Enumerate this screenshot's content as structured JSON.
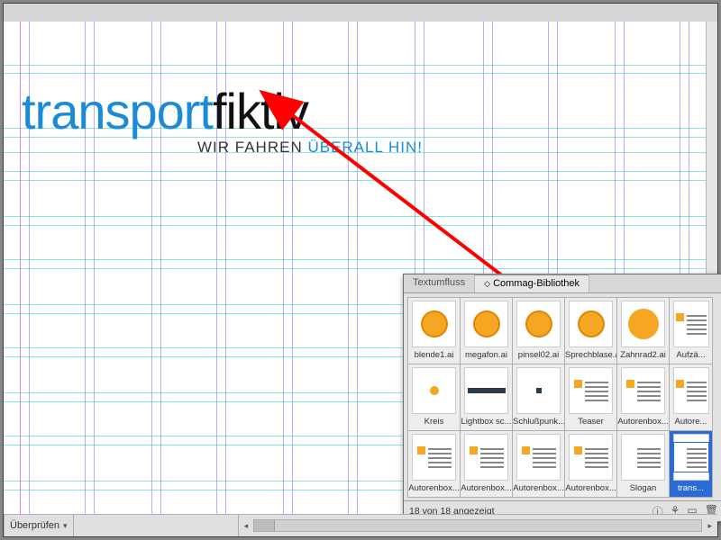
{
  "app": {
    "tab_text_wrap": "Textumfluss",
    "tab_library": "Commag-Bibliothek"
  },
  "document": {
    "logo_part1": "transport",
    "logo_part2": "fiktiv",
    "tagline_part1": "WIR FAHREN ",
    "tagline_part2": "ÜBERALL HIN!"
  },
  "library": {
    "items": [
      {
        "name": "blende1.ai"
      },
      {
        "name": "megafon.ai"
      },
      {
        "name": "pinsel02.ai"
      },
      {
        "name": "Sprechblase.ai"
      },
      {
        "name": "Zahnrad2.ai"
      },
      {
        "name": "Aufzä..."
      },
      {
        "name": "Kreis"
      },
      {
        "name": "Lightbox sc..."
      },
      {
        "name": "Schlußpunk..."
      },
      {
        "name": "Teaser"
      },
      {
        "name": "Autorenbox..."
      },
      {
        "name": "Autore..."
      },
      {
        "name": "Autorenbox..."
      },
      {
        "name": "Autorenbox..."
      },
      {
        "name": "Autorenbox..."
      },
      {
        "name": "Autorenbox..."
      },
      {
        "name": "Slogan"
      },
      {
        "name": "trans..."
      }
    ],
    "footer_count": "18 von 18 angezeigt"
  },
  "bottombar": {
    "label": "Überprüfen"
  }
}
